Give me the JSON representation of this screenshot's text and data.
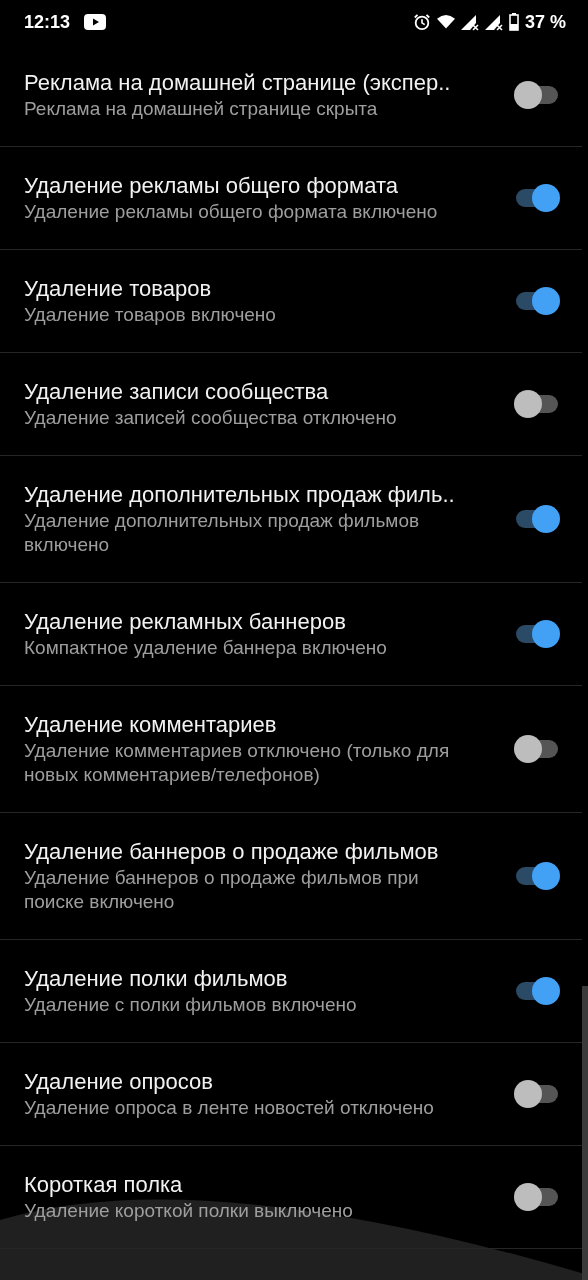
{
  "status_bar": {
    "time": "12:13",
    "battery": "37 %"
  },
  "settings": [
    {
      "title": "Реклама на домашней странице (экспер..",
      "subtitle": "Реклама на домашней странице скрыта",
      "on": false
    },
    {
      "title": "Удаление рекламы общего формата",
      "subtitle": "Удаление рекламы общего формата включено",
      "on": true
    },
    {
      "title": "Удаление товаров",
      "subtitle": "Удаление товаров включено",
      "on": true
    },
    {
      "title": "Удаление записи сообщества",
      "subtitle": "Удаление записей сообщества отключено",
      "on": false
    },
    {
      "title": "Удаление дополнительных продаж филь..",
      "subtitle": "Удаление дополнительных продаж фильмов включено",
      "on": true
    },
    {
      "title": "Удаление рекламных баннеров",
      "subtitle": "Компактное удаление баннера включено",
      "on": true
    },
    {
      "title": "Удаление комментариев",
      "subtitle": "Удаление комментариев отключено (только для новых комментариев/телефонов)",
      "on": false
    },
    {
      "title": "Удаление баннеров о продаже фильмов",
      "subtitle": "Удаление баннеров о продаже фильмов при поиске включено",
      "on": true
    },
    {
      "title": "Удаление полки фильмов",
      "subtitle": "Удаление с полки фильмов включено",
      "on": true
    },
    {
      "title": "Удаление опросов",
      "subtitle": "Удаление опроса в ленте новостей отключено",
      "on": false
    },
    {
      "title": "Короткая полка",
      "subtitle": "Удаление короткой полки выключено",
      "on": false
    }
  ]
}
